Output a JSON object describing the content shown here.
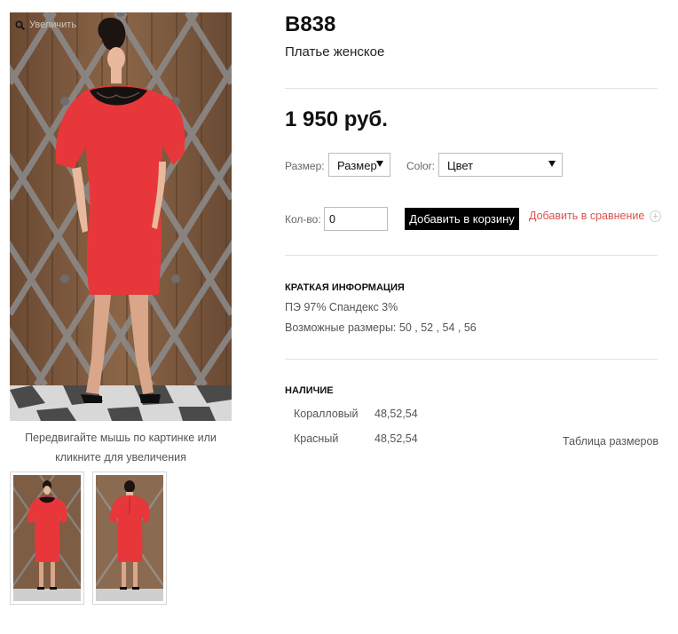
{
  "gallery": {
    "zoom_hint": "Увеличить",
    "caption_line1": "Передвигайте мышь по картинке или",
    "caption_line2": "кликните для увеличения"
  },
  "product": {
    "sku": "B838",
    "name": "Платье женское",
    "price": "1 950 руб.",
    "dress_color": "#e8373a"
  },
  "options": {
    "size_label": "Размер:",
    "size_value": "Размер",
    "color_label": "Color:",
    "color_value": "Цвет",
    "qty_label": "Кол-во:",
    "qty_value": "0"
  },
  "actions": {
    "add_to_cart": "Добавить в корзину",
    "add_to_compare": "Добавить в сравнение"
  },
  "info": {
    "heading": "КРАТКАЯ ИНФОРМАЦИЯ",
    "composition": "ПЭ 97% Спандекс 3%",
    "sizes": "Возможные размеры: 50 , 52 , 54 , 56"
  },
  "availability": {
    "heading": "НАЛИЧИЕ",
    "rows": [
      {
        "color": "Коралловый",
        "sizes": "48,52,54"
      },
      {
        "color": "Красный",
        "sizes": "48,52,54"
      }
    ],
    "size_table_link": "Таблица размеров"
  }
}
